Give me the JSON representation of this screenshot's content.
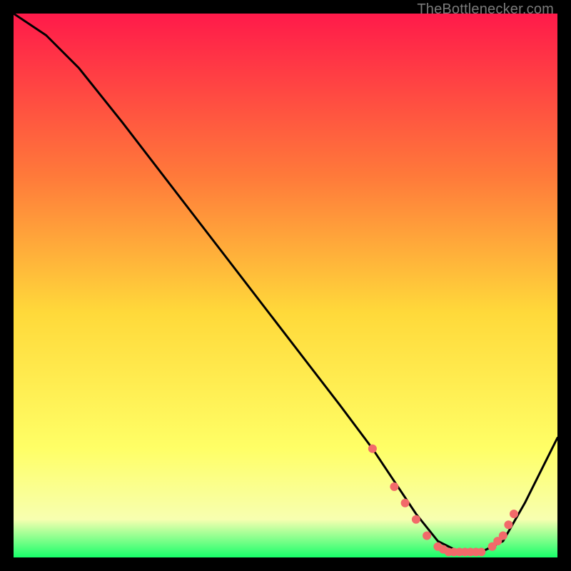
{
  "attribution": "TheBottlenecker.com",
  "colors": {
    "gradient_top": "#ff1a4a",
    "gradient_mid_upper": "#ff7a3a",
    "gradient_mid": "#ffd93a",
    "gradient_lower": "#ffff66",
    "gradient_light": "#f7ffb0",
    "gradient_bottom": "#18ff6a",
    "line": "#000000",
    "marker": "#f26a6a",
    "background": "#000000"
  },
  "chart_data": {
    "type": "line",
    "title": "",
    "xlabel": "",
    "ylabel": "",
    "xlim": [
      0,
      100
    ],
    "ylim": [
      0,
      100
    ],
    "series": [
      {
        "name": "bottleneck-curve",
        "x": [
          0,
          6,
          12,
          20,
          30,
          40,
          50,
          60,
          66,
          70,
          74,
          78,
          82,
          86,
          90,
          94,
          100
        ],
        "y": [
          100,
          96,
          90,
          80,
          67,
          54,
          41,
          28,
          20,
          14,
          8,
          3,
          1,
          1,
          3,
          10,
          22
        ]
      }
    ],
    "markers": {
      "name": "highlight-points",
      "x": [
        66,
        70,
        72,
        74,
        76,
        78,
        79,
        80,
        81,
        82,
        83,
        84,
        85,
        86,
        88,
        89,
        90,
        91,
        92
      ],
      "y": [
        20,
        13,
        10,
        7,
        4,
        2,
        1.5,
        1,
        1,
        1,
        1,
        1,
        1,
        1,
        2,
        3,
        4,
        6,
        8
      ]
    }
  }
}
